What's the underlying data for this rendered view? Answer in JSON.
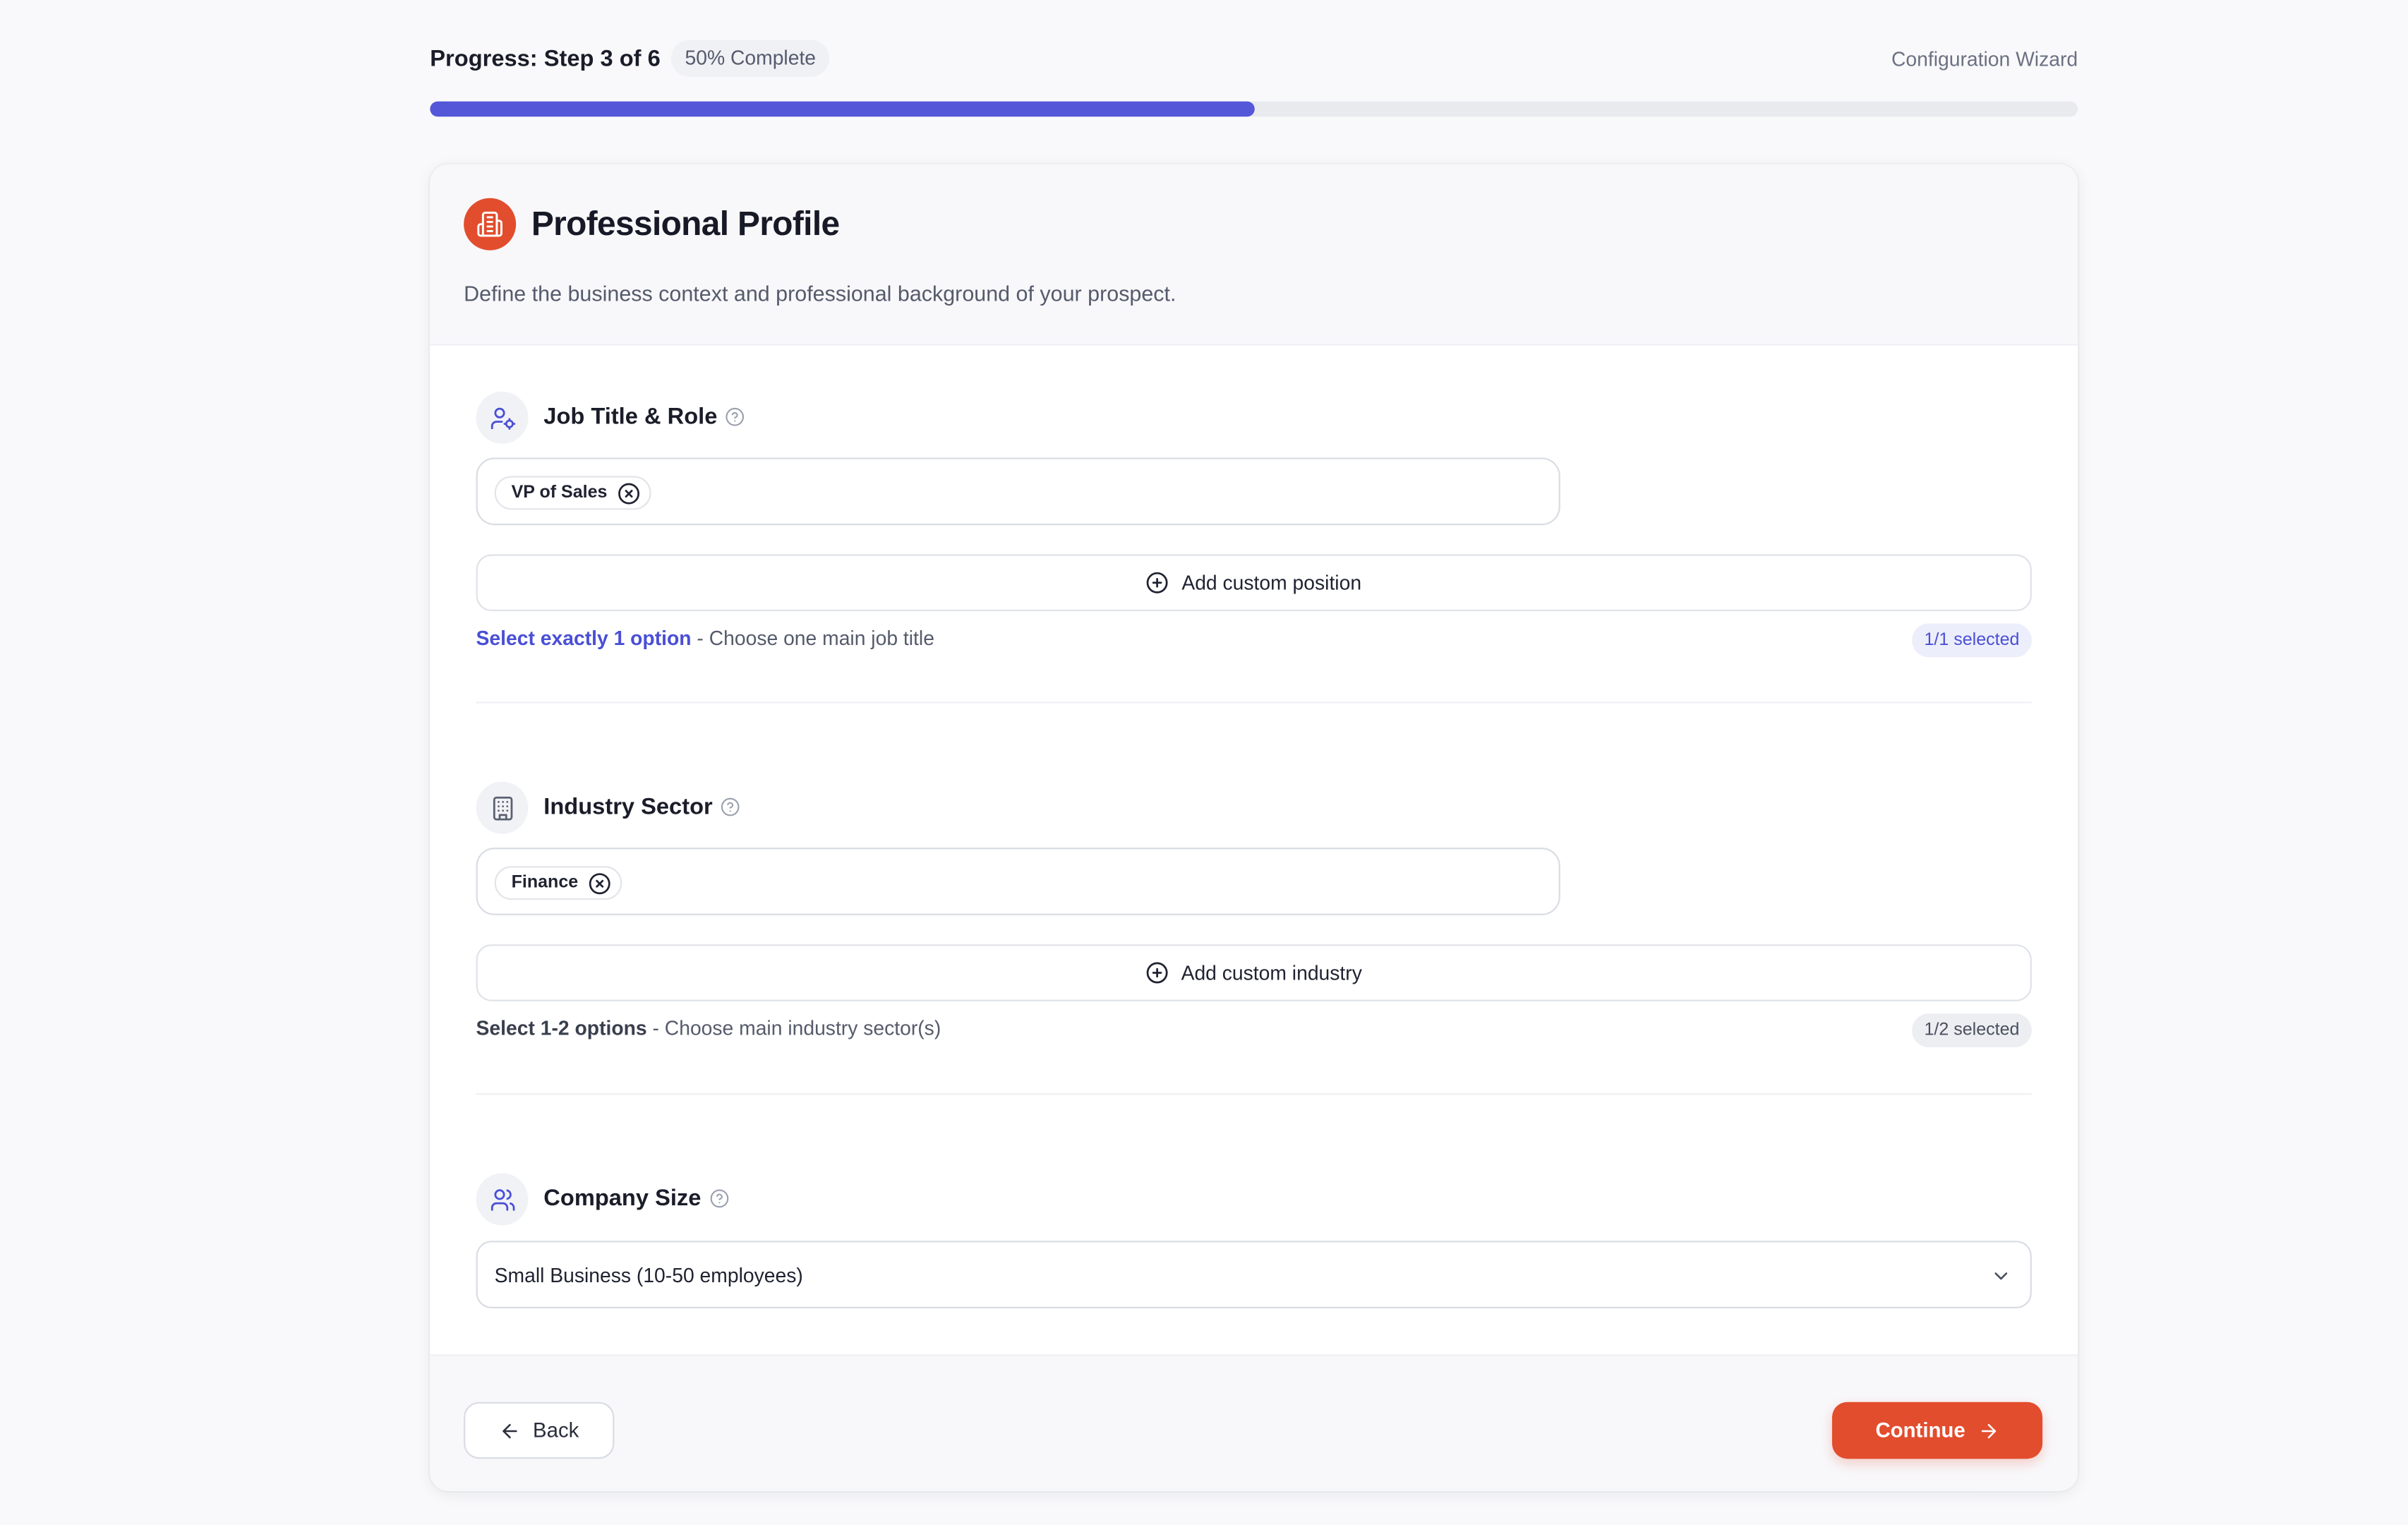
{
  "progress": {
    "title": "Progress: Step 3 of 6",
    "badge": "50% Complete",
    "percent": 50,
    "wizard_label": "Configuration Wizard"
  },
  "card": {
    "title": "Professional Profile",
    "subtitle": "Define the business context and professional background of your prospect.",
    "title_icon": "building-document-icon"
  },
  "sections": {
    "job": {
      "title": "Job Title & Role",
      "icon": "user-cog-icon",
      "tags": [
        "VP of Sales"
      ],
      "add_label": "Add custom position",
      "rule_strong": "Select exactly 1 option",
      "rule_rest": " - Choose one main job title",
      "count": "1/1 selected"
    },
    "industry": {
      "title": "Industry Sector",
      "icon": "building-icon",
      "tags": [
        "Finance"
      ],
      "add_label": "Add custom industry",
      "rule_strong": "Select 1-2 options",
      "rule_rest": " - Choose main industry sector(s)",
      "count": "1/2 selected"
    },
    "company_size": {
      "title": "Company Size",
      "icon": "users-icon",
      "selected_value": "Small Business (10-50 employees)"
    }
  },
  "footer": {
    "back_label": "Back",
    "continue_label": "Continue"
  },
  "colors": {
    "accent": "#5457d8",
    "brand": "#e24d2d",
    "background": "#f9f9fb"
  }
}
